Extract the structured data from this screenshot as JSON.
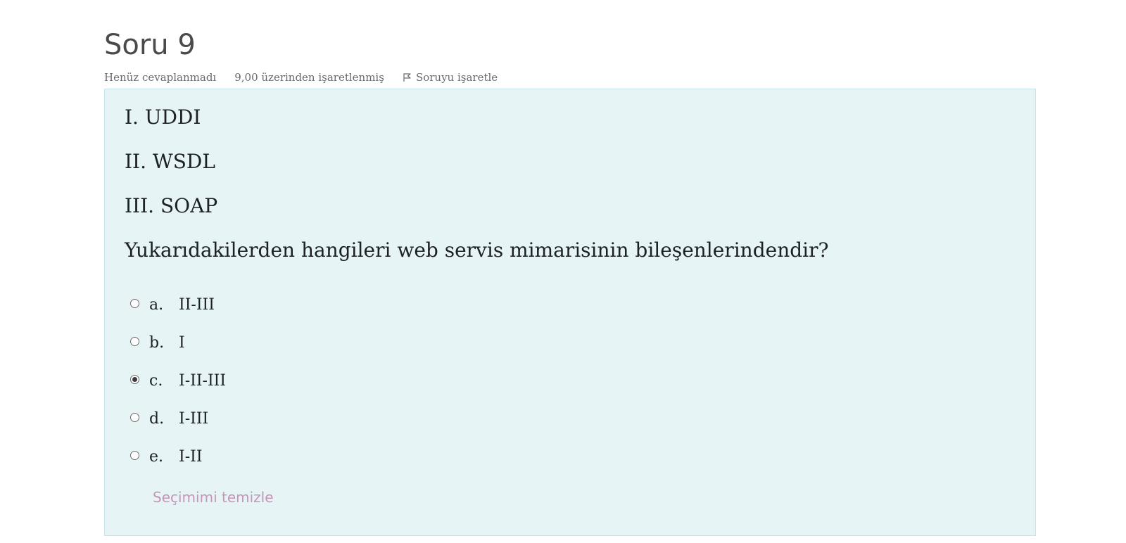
{
  "question": {
    "title": "Soru 9",
    "state": "Henüz cevaplanmadı",
    "grade": "9,00 üzerinden işaretlenmiş",
    "flag_label": "Soruyu işaretle",
    "text_lines": [
      "I. UDDI",
      "II. WSDL",
      "III. SOAP",
      "Yukarıdakilerden hangileri web servis mimarisinin bileşenlerindendir?"
    ]
  },
  "answers": [
    {
      "letter": "a.",
      "text": "II-III",
      "selected": false
    },
    {
      "letter": "b.",
      "text": "I",
      "selected": false
    },
    {
      "letter": "c.",
      "text": "I-II-III",
      "selected": true
    },
    {
      "letter": "d.",
      "text": "I-III",
      "selected": false
    },
    {
      "letter": "e.",
      "text": "I-II",
      "selected": false
    }
  ],
  "clear_choice_label": "Seçimimi temizle",
  "colors": {
    "question_background": "#e7f4f6",
    "question_border": "#c6e4ea",
    "clear_link": "#c497b6",
    "body_text": "#1d2125"
  },
  "icons": {
    "flag": "flag-icon"
  }
}
